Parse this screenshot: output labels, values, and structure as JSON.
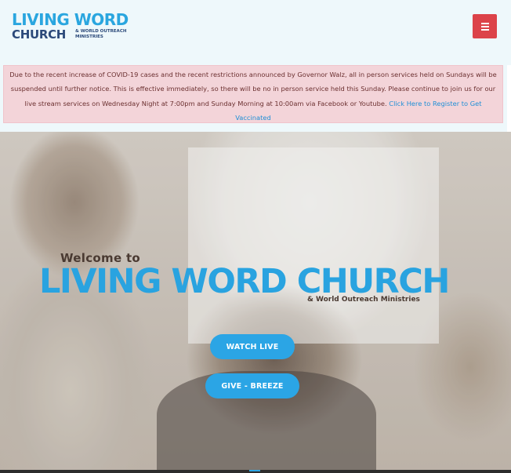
{
  "header": {
    "logo_line1": "LIVING WORD",
    "logo_line2": "CHURCH",
    "logo_sub": "& WORLD OUTREACH MINISTRIES",
    "menu_icon": "hamburger-menu-icon",
    "menu_color": "#dc4349"
  },
  "alert": {
    "text": "Due to the recent increase of COVID-19 cases and the recent restrictions announced by Governor Walz, all in person services held on Sundays will be suspended until further notice. This is effective immediately, so there will be no in person service held this Sunday. Please continue to join us for our live stream services on Wednesday Night at 7:00pm and Sunday Morning at 10:00am via Facebook or Youtube.",
    "link_text": "Click Here to Register to Get Vaccinated"
  },
  "hero": {
    "welcome": "Welcome to",
    "title": "LIVING WORD CHURCH",
    "tagline": "& World Outreach Ministries",
    "watch_label": "WATCH LIVE",
    "give_label": "GIVE - BREEZE",
    "accent_color": "#2ba5e5"
  }
}
